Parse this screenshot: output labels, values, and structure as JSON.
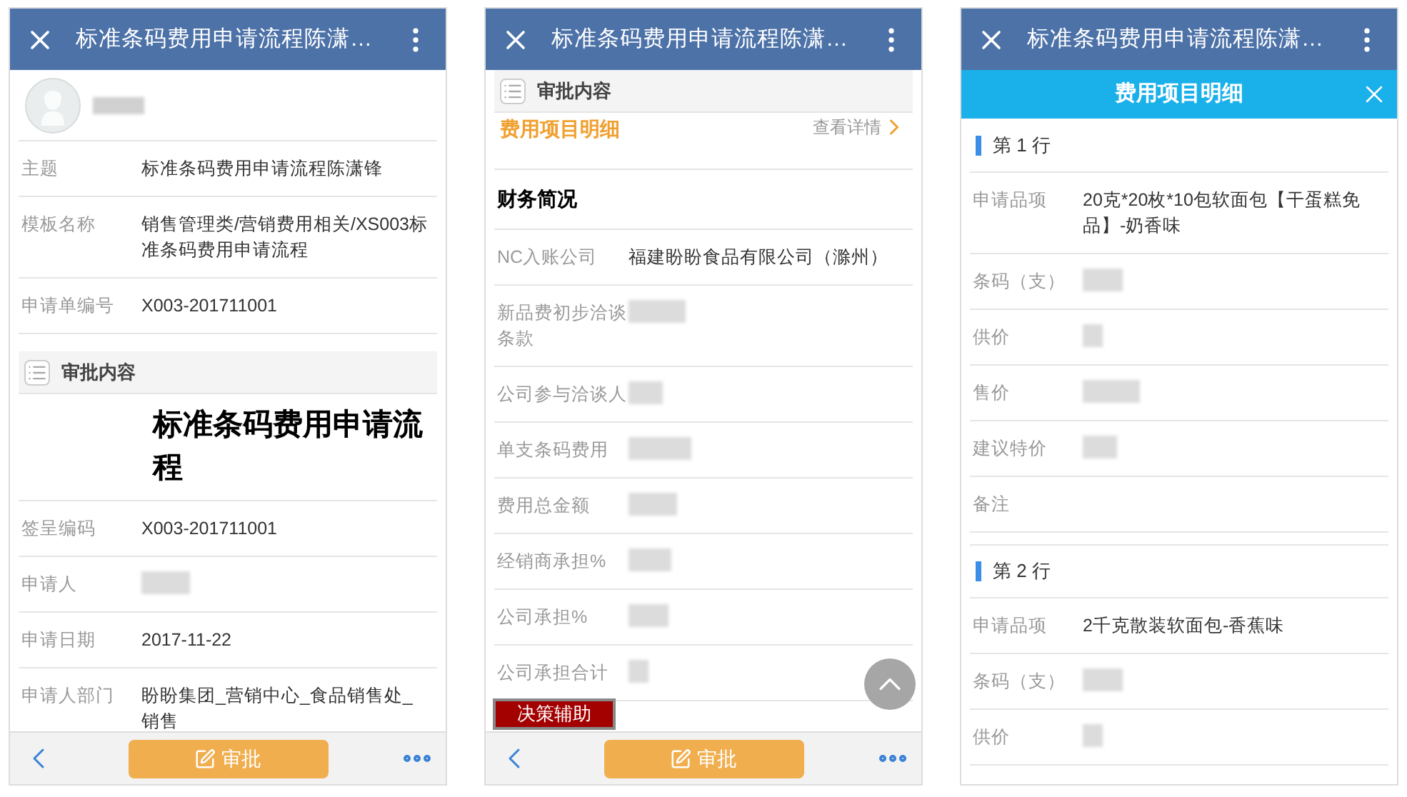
{
  "screens": [
    {
      "header": {
        "title": "标准条码费用申请流程陈潇…"
      },
      "blocks": [
        {
          "kind": "user",
          "blurred": true
        },
        {
          "kind": "field",
          "label": "主题",
          "value": "标准条码费用申请流程陈潇锋"
        },
        {
          "kind": "field",
          "label": "模板名称",
          "value": "销售管理类/营销费用相关/XS003标准条码费用申请流程"
        },
        {
          "kind": "field",
          "label": "申请单编号",
          "value": "X003-201711001"
        },
        {
          "kind": "section",
          "title": "审批内容"
        },
        {
          "kind": "doc_title",
          "title": "标准条码费用申请流程"
        },
        {
          "kind": "field",
          "label": "签呈编码",
          "value": "X003-201711001"
        },
        {
          "kind": "field",
          "label": "申请人",
          "blurred": true
        },
        {
          "kind": "field",
          "label": "申请日期",
          "value": "2017-11-22"
        },
        {
          "kind": "field",
          "label": "申请人部门",
          "value": "盼盼集团_营销中心_食品销售处_销售"
        }
      ],
      "action_bar": {
        "button": "审批"
      }
    },
    {
      "header": {
        "title": "标准条码费用申请流程陈潇…"
      },
      "blocks": [
        {
          "kind": "section",
          "title": "审批内容"
        },
        {
          "kind": "link",
          "title": "费用项目明细",
          "action": "查看详情"
        },
        {
          "kind": "heading",
          "title": "财务简况"
        },
        {
          "kind": "field",
          "label": "NC入账公司",
          "value": "福建盼盼食品有限公司（滁州）"
        },
        {
          "kind": "field",
          "label": "新品费初步洽谈条款",
          "blurred": true
        },
        {
          "kind": "field",
          "label": "公司参与洽谈人",
          "blurred": true
        },
        {
          "kind": "field",
          "label": "单支条码费用",
          "blurred": true
        },
        {
          "kind": "field",
          "label": "费用总金额",
          "blurred": true
        },
        {
          "kind": "field",
          "label": "经销商承担%",
          "blurred": true
        },
        {
          "kind": "field",
          "label": "公司承担%",
          "blurred": true
        },
        {
          "kind": "field",
          "label": "公司承担合计",
          "blurred": true
        }
      ],
      "float_button": "决策辅助",
      "scroll_top": true,
      "action_bar": {
        "button": "审批"
      }
    },
    {
      "header": {
        "title": "标准条码费用申请流程陈潇…"
      },
      "subheader": {
        "title": "费用项目明细"
      },
      "blocks": [
        {
          "kind": "group",
          "title": "第 1 行"
        },
        {
          "kind": "field",
          "label": "申请品项",
          "value": "20克*20枚*10包软面包【干蛋糕免品】-奶香味"
        },
        {
          "kind": "field",
          "label": "条码（支）",
          "blurred": true
        },
        {
          "kind": "field",
          "label": "供价",
          "blurred": true
        },
        {
          "kind": "field",
          "label": "售价",
          "blurred": true
        },
        {
          "kind": "field",
          "label": "建议特价",
          "blurred": true
        },
        {
          "kind": "field",
          "label": "备注"
        },
        {
          "kind": "group",
          "title": "第 2 行"
        },
        {
          "kind": "field",
          "label": "申请品项",
          "value": "2千克散装软面包-香蕉味"
        },
        {
          "kind": "field",
          "label": "条码（支）",
          "blurred": true
        },
        {
          "kind": "field",
          "label": "供价",
          "blurred": true
        }
      ]
    }
  ]
}
